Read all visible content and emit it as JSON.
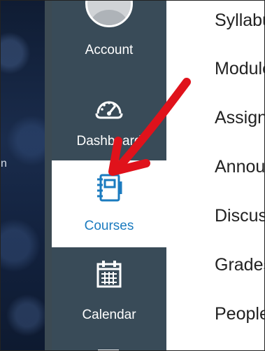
{
  "background": {
    "partial_text": "n"
  },
  "global_nav": {
    "account": {
      "label": "Account",
      "icon": "avatar-icon"
    },
    "dashboard": {
      "label": "Dashboard",
      "icon": "dashboard-gauge-icon"
    },
    "courses": {
      "label": "Courses",
      "icon": "notebook-icon",
      "selected": true
    },
    "calendar": {
      "label": "Calendar",
      "icon": "calendar-icon"
    },
    "next": {
      "icon": "inbox-icon"
    }
  },
  "course_nav": {
    "items": [
      {
        "label": "Syllabus"
      },
      {
        "label": "Modules"
      },
      {
        "label": "Assignments"
      },
      {
        "label": "Announcements"
      },
      {
        "label": "Discussions"
      },
      {
        "label": "Grades"
      },
      {
        "label": "People"
      }
    ]
  },
  "colors": {
    "nav_bg": "#394b58",
    "selected_bg": "#ffffff",
    "selected_text": "#1b7bbf",
    "annotation_arrow": "#e0121b"
  }
}
